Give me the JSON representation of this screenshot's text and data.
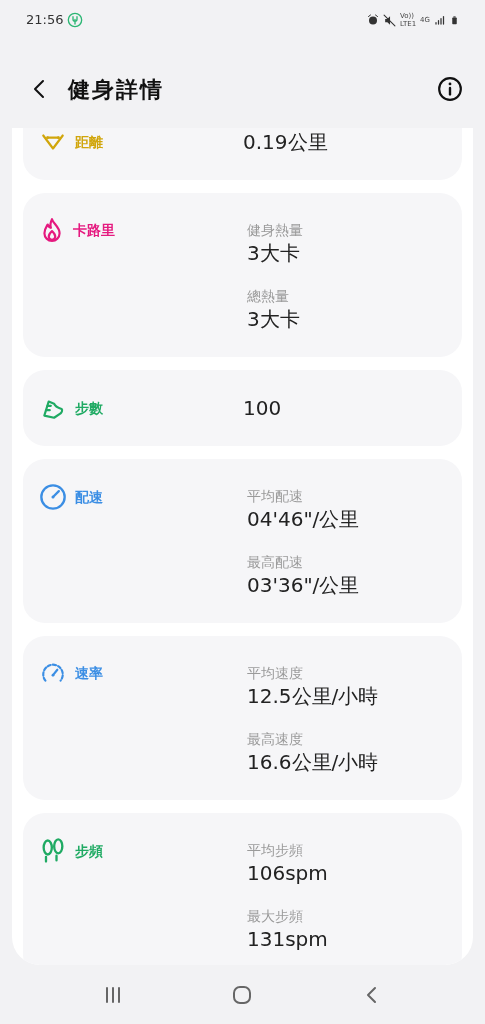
{
  "status_bar": {
    "time": "21:56",
    "volte": "Vo))",
    "lte": "LTE1",
    "network": "4G"
  },
  "header": {
    "title": "健身詳情"
  },
  "sections": [
    {
      "kind": "distance",
      "title": "距離",
      "color": "#d1a60c",
      "metrics": [
        {
          "value": "0.19公里"
        }
      ]
    },
    {
      "kind": "calories",
      "title": "卡路里",
      "color": "#e5197f",
      "metrics": [
        {
          "label": "健身熱量",
          "value": "3大卡"
        },
        {
          "label": "總熱量",
          "value": "3大卡"
        }
      ]
    },
    {
      "kind": "steps",
      "title": "步數",
      "color": "#1faa63",
      "metrics": [
        {
          "value": "100"
        }
      ]
    },
    {
      "kind": "pace",
      "title": "配速",
      "color": "#3b8ee4",
      "metrics": [
        {
          "label": "平均配速",
          "value": "04'46\"/公里"
        },
        {
          "label": "最高配速",
          "value": "03'36\"/公里"
        }
      ]
    },
    {
      "kind": "speed",
      "title": "速率",
      "color": "#3b8ee4",
      "metrics": [
        {
          "label": "平均速度",
          "value": "12.5公里/小時"
        },
        {
          "label": "最高速度",
          "value": "16.6公里/小時"
        }
      ]
    },
    {
      "kind": "cadence",
      "title": "步頻",
      "color": "#1faa63",
      "metrics": [
        {
          "label": "平均步頻",
          "value": "106spm"
        },
        {
          "label": "最大步頻",
          "value": "131spm"
        }
      ]
    }
  ]
}
